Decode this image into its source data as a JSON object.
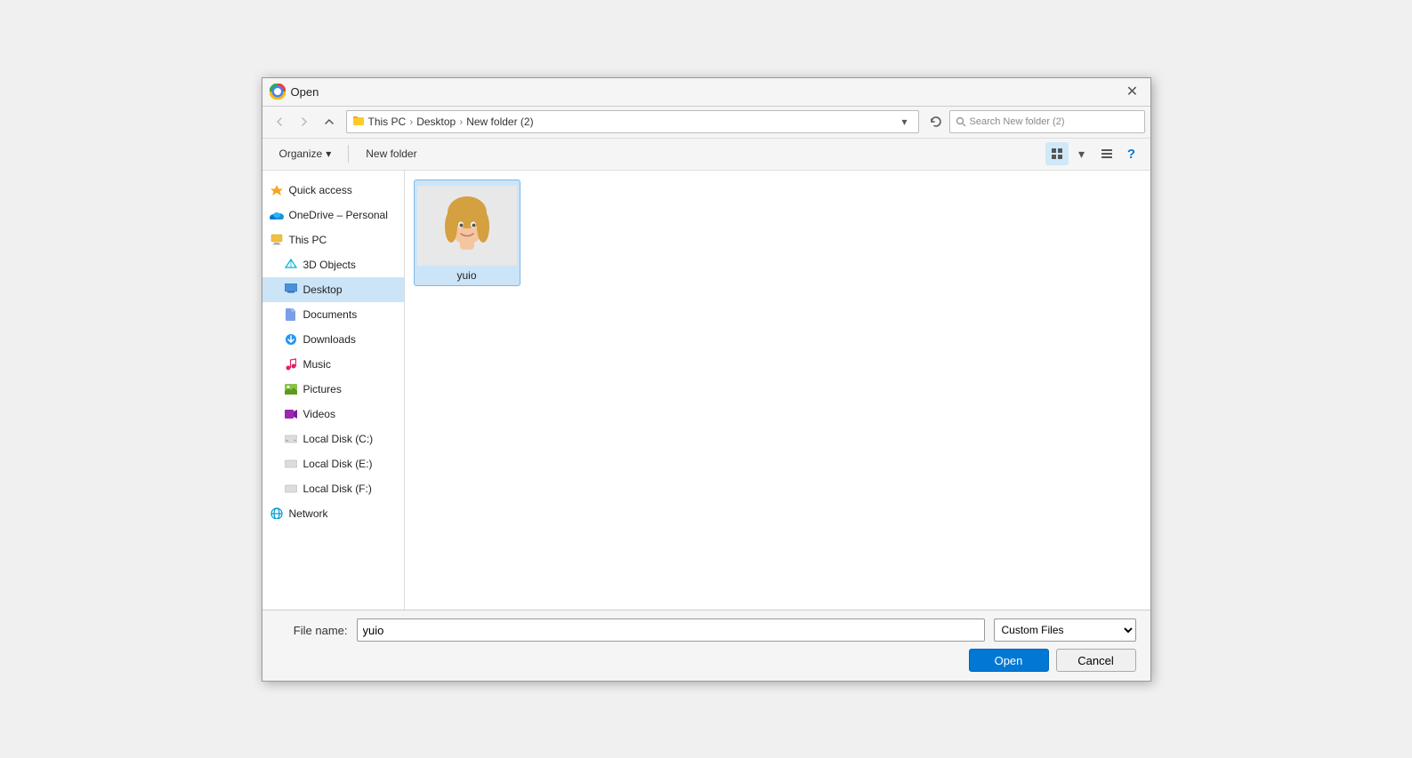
{
  "dialog": {
    "title": "Open",
    "title_icon": "chrome-icon"
  },
  "navbar": {
    "back_label": "←",
    "forward_label": "→",
    "up_label": "↑",
    "breadcrumb": [
      "This PC",
      "Desktop",
      "New folder (2)"
    ],
    "refresh_label": "⟳",
    "search_placeholder": "Search New folder (2)"
  },
  "toolbar": {
    "organize_label": "Organize",
    "new_folder_label": "New folder",
    "view_icon_label": "⊞",
    "toggle_label": "▾",
    "help_label": "?"
  },
  "sidebar": {
    "items": [
      {
        "id": "quick-access",
        "label": "Quick access",
        "icon": "⭐"
      },
      {
        "id": "onedrive",
        "label": "OneDrive – Personal",
        "icon": "☁"
      },
      {
        "id": "thispc",
        "label": "This PC",
        "icon": "💻"
      },
      {
        "id": "3dobjects",
        "label": "3D Objects",
        "icon": "◈"
      },
      {
        "id": "desktop",
        "label": "Desktop",
        "icon": "🖥"
      },
      {
        "id": "documents",
        "label": "Documents",
        "icon": "📄"
      },
      {
        "id": "downloads",
        "label": "Downloads",
        "icon": "⬇"
      },
      {
        "id": "music",
        "label": "Music",
        "icon": "♪"
      },
      {
        "id": "pictures",
        "label": "Pictures",
        "icon": "🖼"
      },
      {
        "id": "videos",
        "label": "Videos",
        "icon": "▶"
      },
      {
        "id": "localdisk-c",
        "label": "Local Disk (C:)",
        "icon": "💾"
      },
      {
        "id": "localdisk-e",
        "label": "Local Disk (E:)",
        "icon": "💾"
      },
      {
        "id": "localdisk-f",
        "label": "Local Disk (F:)",
        "icon": "💾"
      },
      {
        "id": "network",
        "label": "Network",
        "icon": "🌐"
      }
    ]
  },
  "files": [
    {
      "id": "yuio",
      "name": "yuio",
      "type": "image",
      "selected": true
    }
  ],
  "bottom": {
    "filename_label": "File name:",
    "filename_value": "yuio",
    "filetype_value": "Custom Files",
    "open_label": "Open",
    "cancel_label": "Cancel"
  },
  "colors": {
    "accent": "#0078d4",
    "selected_bg": "#cce4f7",
    "selected_border": "#7cb8e8",
    "toolbar_bg": "#f5f5f5"
  }
}
